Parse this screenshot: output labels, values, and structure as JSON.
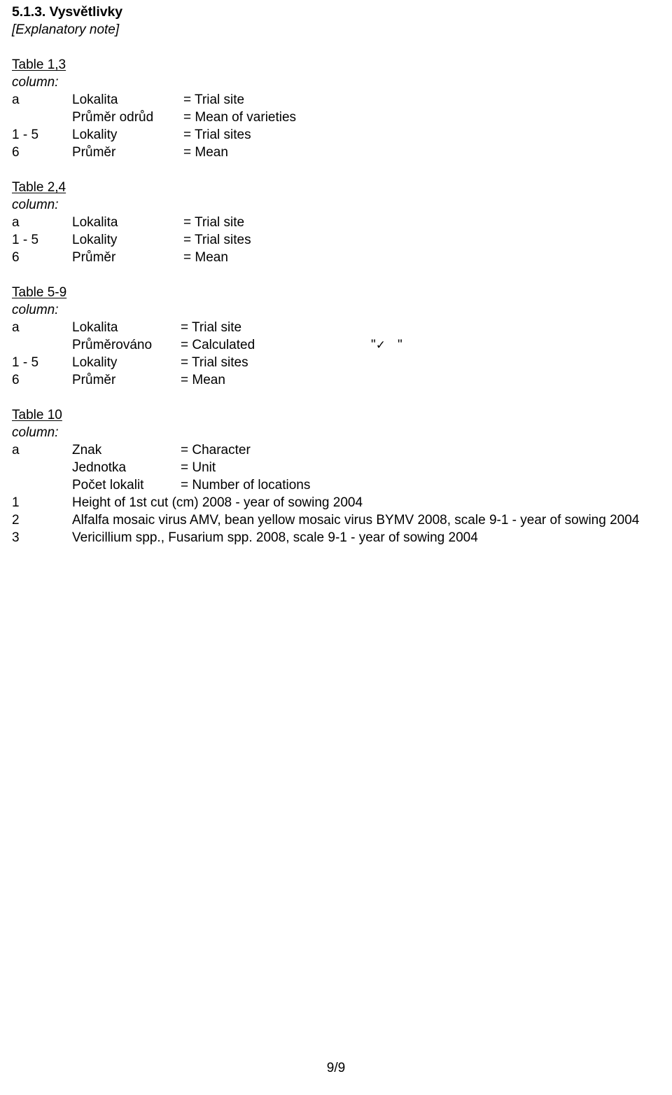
{
  "document": {
    "title": "5.1.3. Vysvětlivky",
    "subtitle": "[Explanatory note]",
    "footer_page": "9/9"
  },
  "labels": {
    "column": "column:"
  },
  "blocks": [
    {
      "heading": "Table 1,3",
      "column_label": "column:",
      "rows": [
        {
          "key": "a",
          "czech": "Lokalita",
          "equals": "= Trial site"
        },
        {
          "key": "",
          "czech": "Průměr odrůd",
          "equals": "= Mean of varieties"
        },
        {
          "key": "1 - 5",
          "czech": "Lokality",
          "equals": "= Trial sites"
        },
        {
          "key": "6",
          "czech": "Průměr",
          "equals": "= Mean"
        }
      ]
    },
    {
      "heading": "Table 2,4",
      "column_label": "column:",
      "rows": [
        {
          "key": "a",
          "czech": "Lokalita",
          "equals": "= Trial site"
        },
        {
          "key": "1 - 5",
          "czech": "Lokality",
          "equals": "= Trial sites"
        },
        {
          "key": "6",
          "czech": "Průměr",
          "equals": "= Mean"
        }
      ]
    },
    {
      "heading": "Table 5-9",
      "column_label": "column:",
      "rows": [
        {
          "key": "a",
          "czech": "Lokalita",
          "equals": "= Trial site"
        },
        {
          "key": "",
          "czech": "Průměrováno",
          "equals": "= Calculated",
          "note_open": "\"",
          "note_symbol": "✓",
          "note_close": "\""
        },
        {
          "key": "1 - 5",
          "czech": "Lokality",
          "equals": "= Trial sites"
        },
        {
          "key": "6",
          "czech": "Průměr",
          "equals": "= Mean"
        }
      ]
    },
    {
      "heading": "Table 10",
      "column_label": "column:",
      "rows": [
        {
          "key": "a",
          "czech": "Znak",
          "equals": "= Character"
        },
        {
          "key": "",
          "czech": "Jednotka",
          "equals": "= Unit"
        },
        {
          "key": "",
          "czech": "Počet lokalit",
          "equals": "= Number of locations"
        }
      ],
      "notes": [
        {
          "key": "1",
          "text": "Height of 1st cut (cm) 2008 - year of sowing 2004"
        },
        {
          "key": "2",
          "text": "Alfalfa mosaic virus AMV, bean yellow mosaic virus BYMV 2008, scale 9-1 - year of sowing 2004"
        },
        {
          "key": "3",
          "text": "Vericillium spp., Fusarium spp. 2008, scale 9-1 - year of sowing 2004"
        }
      ]
    }
  ]
}
